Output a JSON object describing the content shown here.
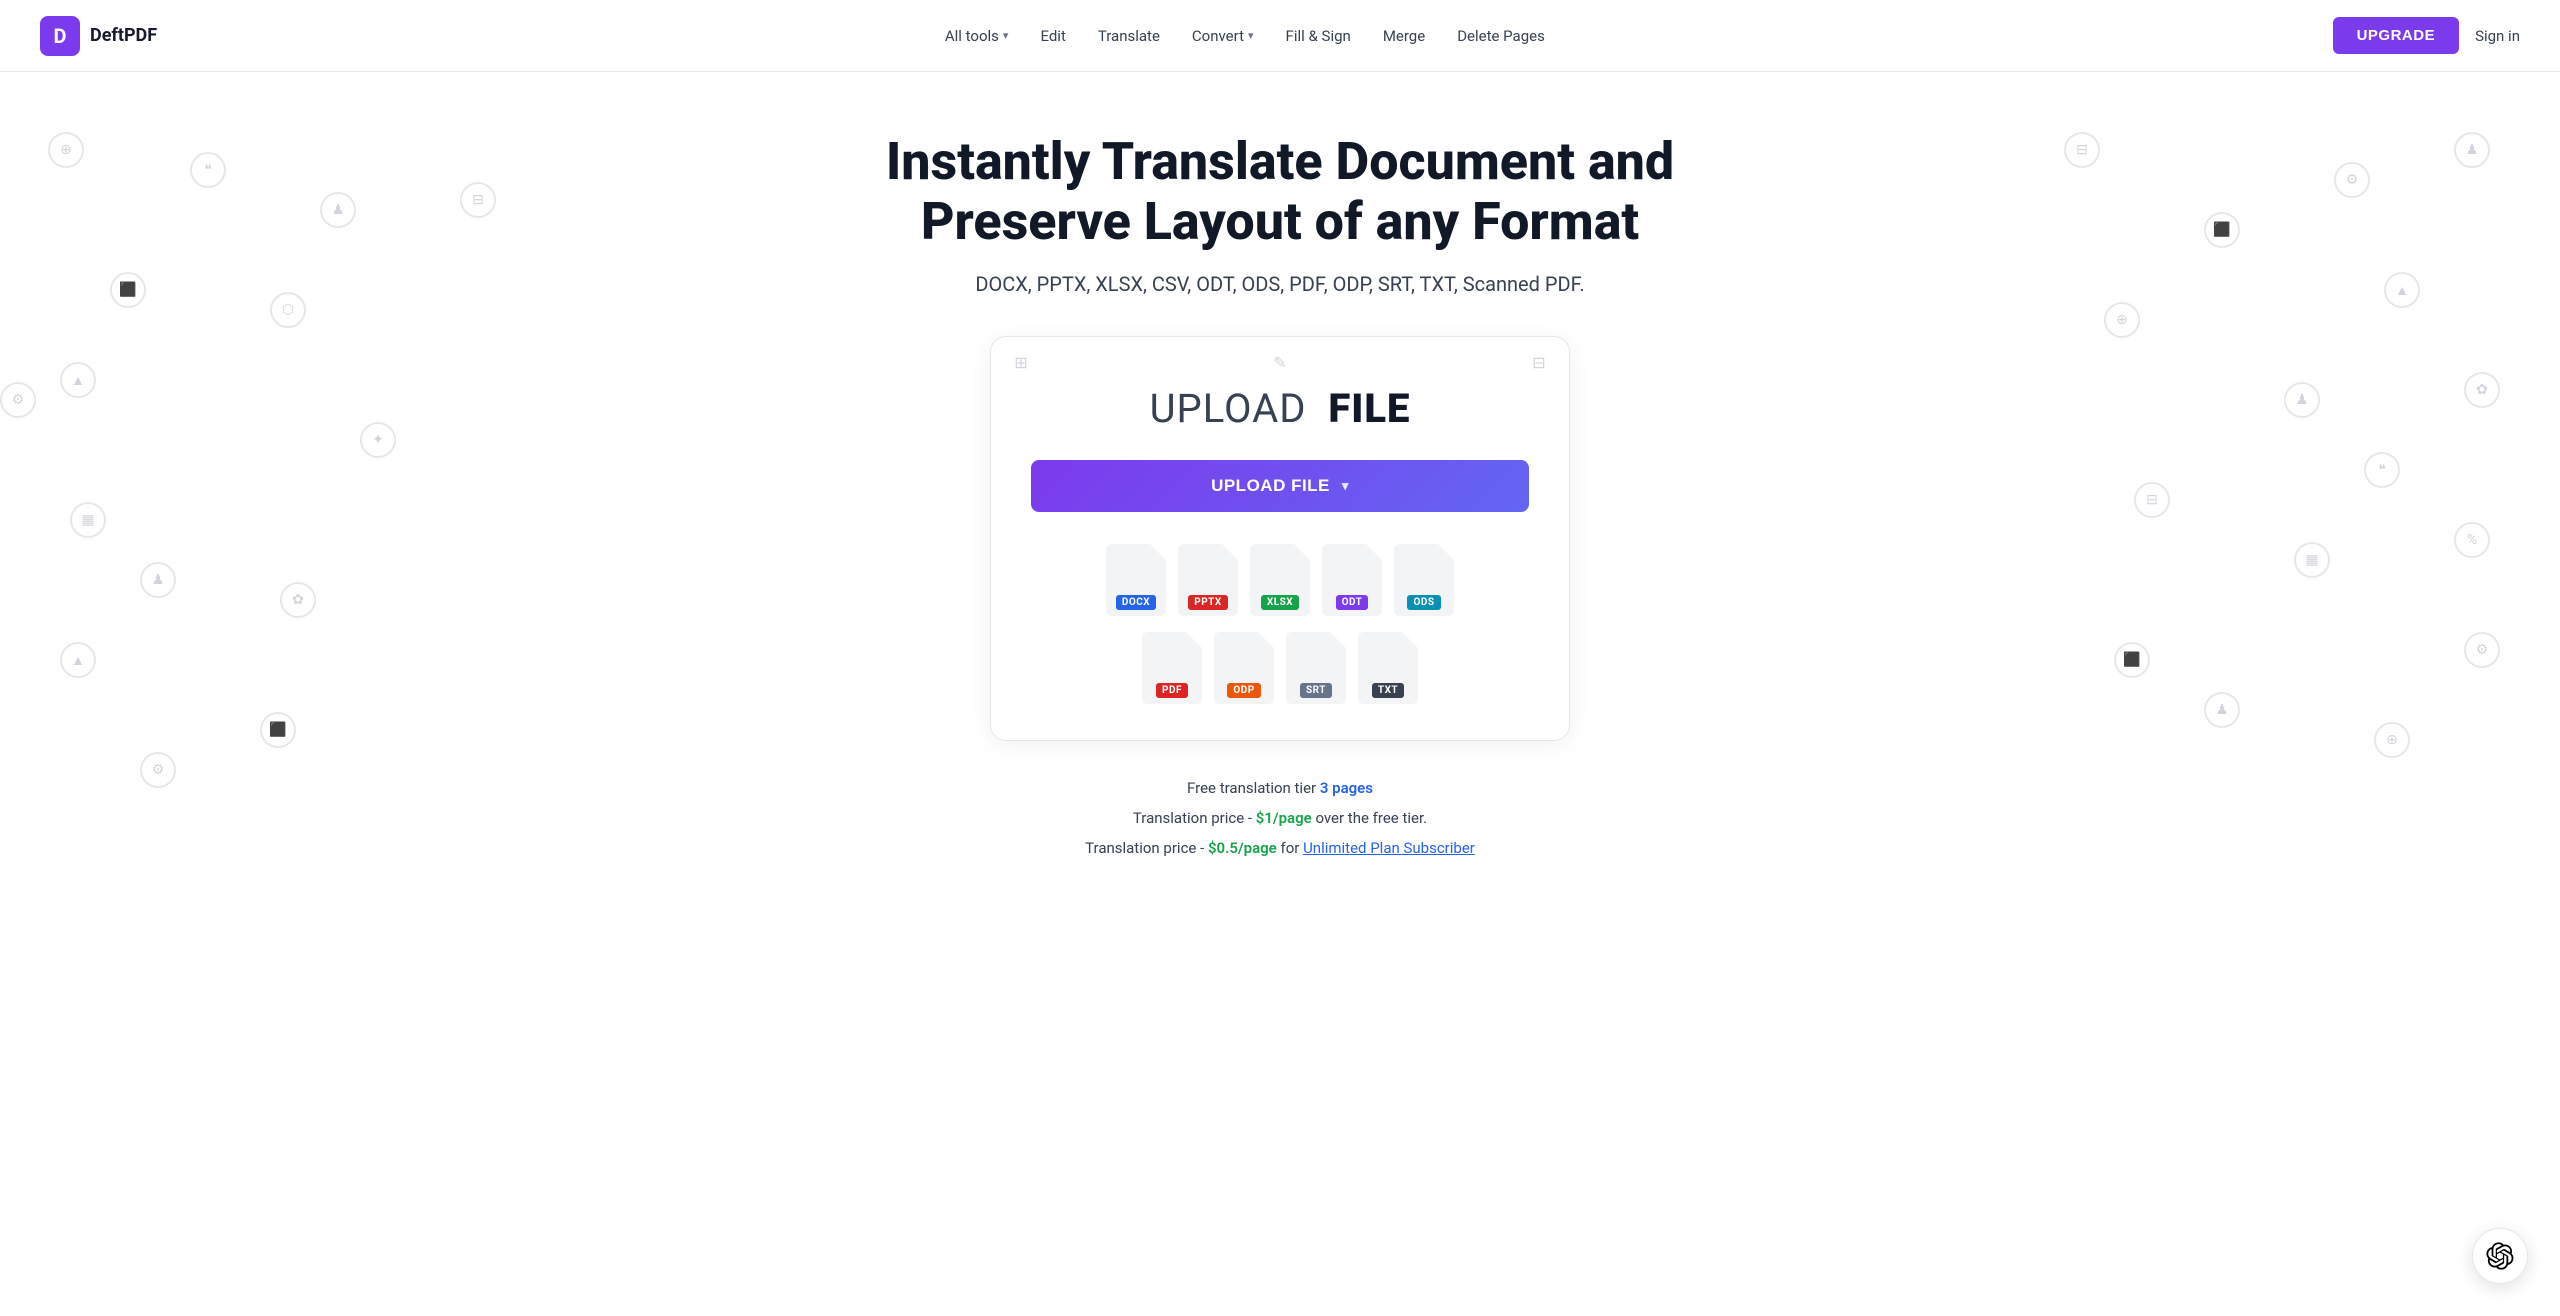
{
  "logo": {
    "icon_letter": "D",
    "name": "DeftPDF"
  },
  "nav": {
    "links": [
      {
        "label": "All tools",
        "has_dropdown": true
      },
      {
        "label": "Edit",
        "has_dropdown": false
      },
      {
        "label": "Translate",
        "has_dropdown": false
      },
      {
        "label": "Convert",
        "has_dropdown": true
      },
      {
        "label": "Fill & Sign",
        "has_dropdown": false
      },
      {
        "label": "Merge",
        "has_dropdown": false
      },
      {
        "label": "Delete Pages",
        "has_dropdown": false
      }
    ],
    "upgrade_label": "UPGRADE",
    "signin_label": "Sign in"
  },
  "hero": {
    "title": "Instantly Translate Document and Preserve Layout of any Format",
    "subtitle": "DOCX, PPTX, XLSX, CSV, ODT, ODS, PDF, ODP, SRT, TXT, Scanned PDF."
  },
  "upload_card": {
    "title_light": "UPLOAD",
    "title_bold": "FILE",
    "upload_button_label": "UPLOAD FILE",
    "file_formats_row1": [
      {
        "label": "DOCX",
        "badge_class": "badge-docx"
      },
      {
        "label": "PPTX",
        "badge_class": "badge-pptx"
      },
      {
        "label": "XLSX",
        "badge_class": "badge-xlsx"
      },
      {
        "label": "ODT",
        "badge_class": "badge-odt"
      },
      {
        "label": "ODS",
        "badge_class": "badge-ods"
      }
    ],
    "file_formats_row2": [
      {
        "label": "PDF",
        "badge_class": "badge-pdf"
      },
      {
        "label": "ODP",
        "badge_class": "badge-odp"
      },
      {
        "label": "SRT",
        "badge_class": "badge-srt"
      },
      {
        "label": "TXT",
        "badge_class": "badge-txt"
      }
    ]
  },
  "pricing": {
    "line1_prefix": "Free translation tier ",
    "line1_highlight": "3 pages",
    "line2_prefix": "Translation price - ",
    "line2_highlight": "$1/page",
    "line2_suffix": " over the free tier.",
    "line3_prefix": "Translation price - ",
    "line3_highlight": "$0.5/page",
    "line3_middle": " for ",
    "line3_link": "Unlimited Plan Subscriber"
  },
  "ai_chat": {
    "aria_label": "AI Chat"
  }
}
